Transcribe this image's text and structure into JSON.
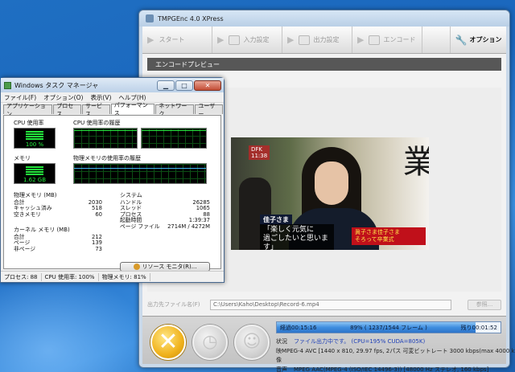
{
  "tmpgenc": {
    "title": "TMPGEnc 4.0 XPress",
    "toolbar": {
      "start": "スタート",
      "input": "入力設定",
      "output": "出力設定",
      "encode": "エンコード",
      "option": "オプション"
    },
    "preview_label": "エンコードプレビュー",
    "video": {
      "logo": "DFK",
      "time": "11:38",
      "name_tag": "佳子さま",
      "caption_line1": "「楽しく元気に",
      "caption_line2": "過ごしたいと思います」",
      "red_caption_line1": "眞子さま佳子さま",
      "red_caption_line2": "そろって卒業式",
      "kanji": "業"
    },
    "output_label": "出力先ファイル名(F)",
    "output_path": "C:\\Users\\Kaho\\Desktop\\Record-6.mp4",
    "browse_label": "参照...",
    "progress": {
      "elapsed": "経過00:15:16",
      "center": "89% ( 1237/1544 フレーム )",
      "remaining": "残り00:01:52",
      "fraction": 0.89
    },
    "info": [
      {
        "key": "状況",
        "value": "ファイル出力中です。  (CPU=195% CUDA=805K)",
        "blue": true
      },
      {
        "key": "映像",
        "value": "MPEG-4 AVC [1440 x 810, 29.97 fps, 2パス 可変ビットレート 3000 kbps(max 4000 kbps",
        "blue": false
      },
      {
        "key": "音声",
        "value": "MPEG AAC(MPEG-4 (ISO/IEC 14496-3)) [48000 Hz ステレオ, 160 kbps]",
        "blue": false
      }
    ]
  },
  "taskmgr": {
    "title": "Windows タスク マネージャ",
    "menu": [
      "ファイル(F)",
      "オプション(O)",
      "表示(V)",
      "ヘルプ(H)"
    ],
    "tabs": [
      "アプリケーション",
      "プロセス",
      "サービス",
      "パフォーマンス",
      "ネットワーク",
      "ユーザー"
    ],
    "active_tab": 3,
    "cpu_usage_label": "CPU 使用率",
    "cpu_usage_value": "100 %",
    "cpu_history_label": "CPU 使用率の履歴",
    "memory_label": "メモリ",
    "memory_value": "1.62 GB",
    "memory_history_label": "物理メモリの使用率の履歴",
    "physical_memory": {
      "title": "物理メモリ (MB)",
      "rows": [
        {
          "k": "合計",
          "v": "2030"
        },
        {
          "k": "キャッシュ済み",
          "v": "518"
        },
        {
          "k": "空きメモリ",
          "v": "60"
        }
      ]
    },
    "kernel_memory": {
      "title": "カーネル メモリ (MB)",
      "rows": [
        {
          "k": "合計",
          "v": "212"
        },
        {
          "k": "ページ",
          "v": "139"
        },
        {
          "k": "非ページ",
          "v": "73"
        }
      ]
    },
    "system": {
      "title": "システム",
      "rows": [
        {
          "k": "ハンドル",
          "v": "26285"
        },
        {
          "k": "スレッド",
          "v": "1065"
        },
        {
          "k": "プロセス",
          "v": "88"
        },
        {
          "k": "起動時間",
          "v": "1:39:37"
        },
        {
          "k": "ページ ファイル",
          "v": "2714M / 4272M"
        }
      ]
    },
    "resource_monitor_button": "リソース モニタ(R)...",
    "status": {
      "processes": "プロセス: 88",
      "cpu": "CPU 使用率: 100%",
      "memory": "物理メモリ: 81%"
    }
  }
}
